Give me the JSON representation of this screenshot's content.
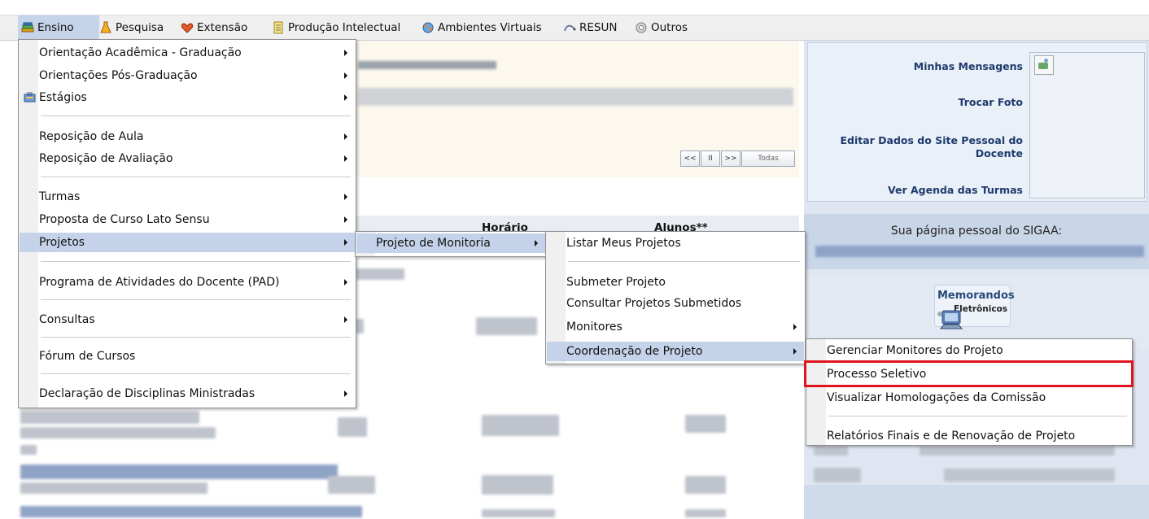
{
  "menubar": [
    {
      "label": "Ensino",
      "icon": "book-stack-icon",
      "active": true
    },
    {
      "label": "Pesquisa",
      "icon": "flask-icon"
    },
    {
      "label": "Extensão",
      "icon": "heart-icon"
    },
    {
      "label": "Produção Intelectual",
      "icon": "document-icon"
    },
    {
      "label": "Ambientes Virtuais",
      "icon": "globe-people-icon"
    },
    {
      "label": "RESUN",
      "icon": "chart-icon"
    },
    {
      "label": "Outros",
      "icon": "gear-icon"
    }
  ],
  "ensino_menu": [
    {
      "label": "Orientação Acadêmica - Graduação",
      "submenu": true
    },
    {
      "label": "Orientações Pós-Graduação",
      "submenu": true
    },
    {
      "label": "Estágios",
      "submenu": true,
      "icon": "briefcase-icon"
    },
    {
      "label": "Reposição de Aula",
      "submenu": true
    },
    {
      "label": "Reposição de Avaliação",
      "submenu": true
    },
    {
      "label": "Turmas",
      "submenu": true
    },
    {
      "label": "Proposta de Curso Lato Sensu",
      "submenu": true
    },
    {
      "label": "Projetos",
      "submenu": true,
      "highlighted": true
    },
    {
      "label": "Programa de Atividades do Docente (PAD)",
      "submenu": true
    },
    {
      "label": "Consultas",
      "submenu": true
    },
    {
      "label": "Fórum de Cursos",
      "submenu": false
    },
    {
      "label": "Declaração de Disciplinas Ministradas",
      "submenu": true
    }
  ],
  "projetos_menu": [
    {
      "label": "Projeto de Monitoria",
      "submenu": true,
      "highlighted": true
    }
  ],
  "monitoria_menu": [
    {
      "label": "Listar Meus Projetos"
    },
    {
      "label": "Submeter Projeto"
    },
    {
      "label": "Consultar Projetos Submetidos"
    },
    {
      "label": "Monitores",
      "submenu": true
    },
    {
      "label": "Coordenação de Projeto",
      "submenu": true,
      "highlighted": true
    }
  ],
  "coordenacao_menu": [
    {
      "label": "Gerenciar Monitores do Projeto"
    },
    {
      "label": "Processo Seletivo",
      "outlined": true
    },
    {
      "label": "Visualizar Homologações da Comissão"
    },
    {
      "label": "Relatórios Finais e de Renovação de Projeto"
    }
  ],
  "pagination": [
    "<<",
    "II",
    ">>",
    "Todas"
  ],
  "table_headers": {
    "horario": "Horário",
    "alunos": "Alunos**"
  },
  "sidebar": {
    "links": [
      "Minhas Mensagens",
      "Trocar Foto",
      "Editar Dados do Site Pessoal do Docente",
      "Ver Agenda das Turmas"
    ],
    "pagina_pessoal": "Sua página pessoal do SIGAA:",
    "memorandos_title": "Memorandos",
    "memorandos_sub": "Eletrônicos"
  },
  "colors": {
    "highlight": "#c5d3ea",
    "outline": "#e0141e",
    "menubar": "#efefef",
    "panel_bg": "#fdf8ee",
    "right_panel": "#dfe6f1"
  }
}
